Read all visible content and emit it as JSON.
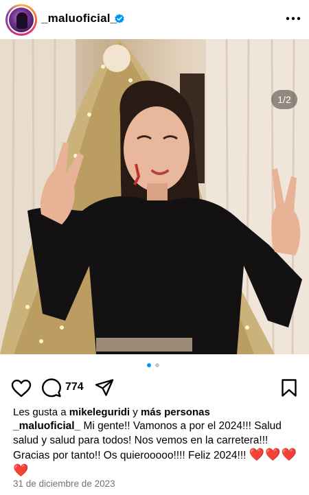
{
  "post": {
    "username": "_maluoficial_",
    "verified": true,
    "carousel_counter": "1/2",
    "carousel_total": 2,
    "carousel_active": 1,
    "comment_count": "774",
    "likes_prefix": "Les gusta a ",
    "likes_user": "mikeleguridi",
    "likes_middle": " y ",
    "likes_others": "más personas",
    "caption_user": "_maluoficial_",
    "caption_text": " Mi gente!! Vamonos a por el 2024!!! Salud salud y salud para todos! Nos vemos en la carretera!!! Gracias por tanto!! Os quierooooo!!!! Feliz 2024!!!",
    "caption_emojis": "❤️❤️❤️❤️",
    "date": "31 de diciembre de 2023"
  },
  "icons": {
    "verified": "verified-badge-icon",
    "more": "more-options-icon",
    "like": "heart-icon",
    "comment": "comment-bubble-icon",
    "share": "send-icon",
    "save": "bookmark-icon"
  },
  "colors": {
    "verified": "#0095f6",
    "dot_active": "#0095f6",
    "dot_inactive": "#c7c7c7",
    "date": "#737373",
    "heart_emoji": "#e0202e"
  }
}
